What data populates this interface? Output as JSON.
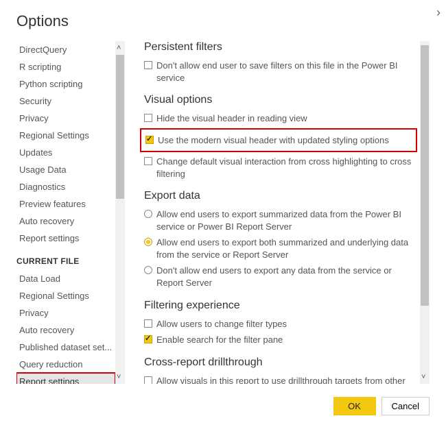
{
  "title": "Options",
  "sidebar": {
    "global_items": [
      "DirectQuery",
      "R scripting",
      "Python scripting",
      "Security",
      "Privacy",
      "Regional Settings",
      "Updates",
      "Usage Data",
      "Diagnostics",
      "Preview features",
      "Auto recovery",
      "Report settings"
    ],
    "section_header": "CURRENT FILE",
    "file_items": [
      "Data Load",
      "Regional Settings",
      "Privacy",
      "Auto recovery",
      "Published dataset set...",
      "Query reduction",
      "Report settings"
    ],
    "selected": "Report settings"
  },
  "sections": {
    "persistent": {
      "title": "Persistent filters",
      "opt1": "Don't allow end user to save filters on this file in the Power BI service"
    },
    "visual": {
      "title": "Visual options",
      "opt1": "Hide the visual header in reading view",
      "opt2": "Use the modern visual header with updated styling options",
      "opt3": "Change default visual interaction from cross highlighting to cross filtering"
    },
    "export": {
      "title": "Export data",
      "opt1": "Allow end users to export summarized data from the Power BI service or Power BI Report Server",
      "opt2": "Allow end users to export both summarized and underlying data from the service or Report Server",
      "opt3": "Don't allow end users to export any data from the service or Report Server"
    },
    "filtering": {
      "title": "Filtering experience",
      "opt1": "Allow users to change filter types",
      "opt2": "Enable search for the filter pane"
    },
    "cross": {
      "title": "Cross-report drillthrough",
      "opt1": "Allow visuals in this report to use drillthrough targets from other reports"
    }
  },
  "buttons": {
    "ok": "OK",
    "cancel": "Cancel"
  }
}
